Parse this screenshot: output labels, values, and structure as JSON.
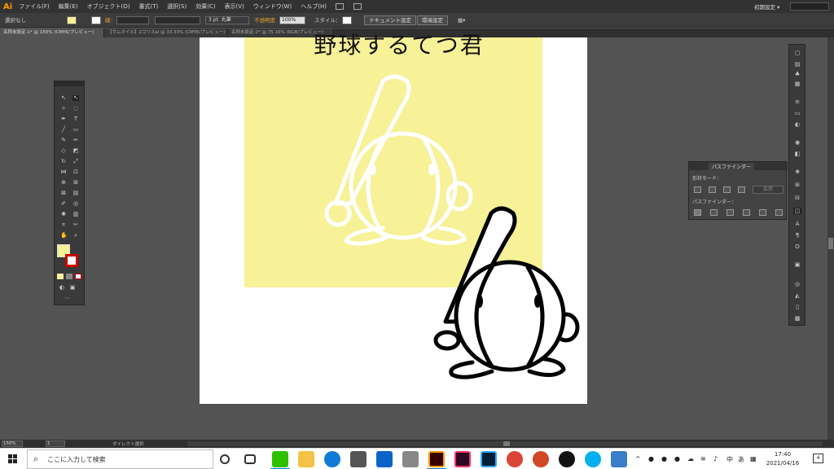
{
  "app": {
    "logo": "Ai",
    "workspace": "初期設定 ▾"
  },
  "menu": [
    "ファイル(F)",
    "編集(E)",
    "オブジェクト(O)",
    "書式(T)",
    "選択(S)",
    "効果(C)",
    "表示(V)",
    "ウィンドウ(W)",
    "ヘルプ(H)"
  ],
  "control": {
    "selection": "選択なし",
    "stroke_label": "線：",
    "stroke_weight": "3 pt. 丸筆",
    "opacity_label": "不透明度",
    "opacity": "100%",
    "style_label": "スタイル：",
    "doc_setup": "ドキュメント設定",
    "prefs": "環境設定"
  },
  "tabs": [
    "名称未設定-1* @ 150% (CMYK/プレビュー)",
    "【サムネイル】2コリスai @ 33.33% (CMYK/プレビュー)",
    "名称未設定-2* @ 75.16% (RGB/プレビュー)"
  ],
  "artboard": {
    "headline": "野球するてつ君",
    "fill_color": "#f7f197"
  },
  "pathfinder": {
    "title": "パスファインダー",
    "shape_modes": "形状モード：",
    "expand": "拡張",
    "pathfinders": "パスファインダー："
  },
  "status": {
    "zoom": "150%",
    "page": "1",
    "tool": "ダイレクト選択"
  },
  "taskbar": {
    "search_placeholder": "ここに入力して検索",
    "time": "17:40",
    "date": "2021/04/16",
    "ime": "あ",
    "notifications": "4"
  },
  "colors": {
    "accent": "#ff9a00",
    "fill": "#f7f197",
    "stroke": "#cc0000"
  }
}
